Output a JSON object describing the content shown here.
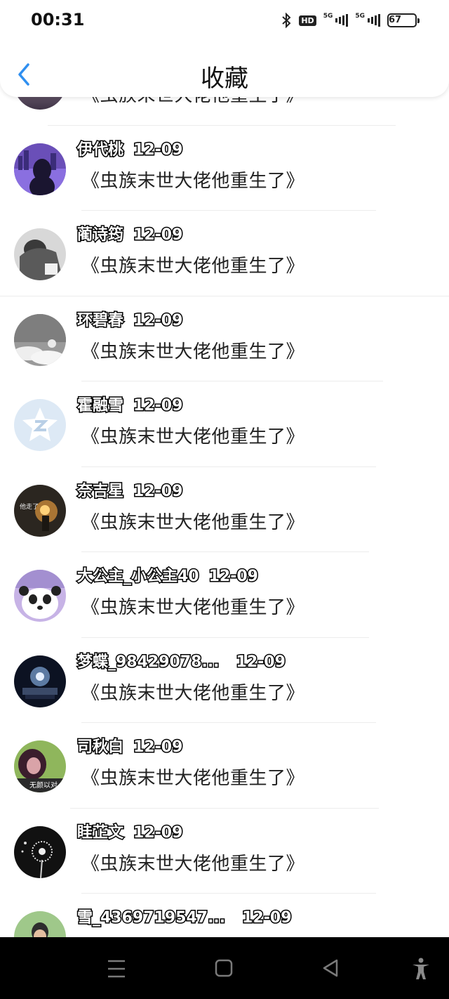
{
  "status_bar": {
    "time": "00:31",
    "hd_label": "HD",
    "signal_1_label": "5G",
    "signal_2_label": "5G",
    "battery": "67"
  },
  "header": {
    "title": "收藏",
    "back_icon": "chevron-left-icon"
  },
  "items": [
    {
      "name": "",
      "date": "",
      "title": "《虫族末世大佬他重生了》"
    },
    {
      "name": "伊代桃",
      "date": "12-09",
      "title": "《虫族末世大佬他重生了》"
    },
    {
      "name": "蔺诗筠",
      "date": "12-09",
      "title": "《虫族末世大佬他重生了》"
    },
    {
      "name": "环碧春",
      "date": "12-09",
      "title": "《虫族末世大佬他重生了》"
    },
    {
      "name": "霍融雪",
      "date": "12-09",
      "title": "《虫族末世大佬他重生了》"
    },
    {
      "name": "奈吉星",
      "date": "12-09",
      "title": "《虫族末世大佬他重生了》"
    },
    {
      "name": "大公主_小公主40",
      "date": "12-09",
      "title": "《虫族末世大佬他重生了》"
    },
    {
      "name": "梦蝶_98429078...",
      "date": "12-09",
      "title": "《虫族末世大佬他重生了》"
    },
    {
      "name": "司秋白",
      "date": "12-09",
      "title": "《虫族末世大佬他重生了》"
    },
    {
      "name": "眭芷文",
      "date": "12-09",
      "title": "《虫族末世大佬他重生了》"
    },
    {
      "name": "雪_4369719547...",
      "date": "12-09",
      "title": ""
    }
  ],
  "avatar_text": {
    "item5": "他走了",
    "item8": "无颜以对"
  },
  "colors": {
    "accent": "#2f8ff0",
    "nav_bg": "#000000",
    "separator": "#ececec"
  },
  "nav_icons": [
    "menu-icon",
    "home-square-icon",
    "back-triangle-icon",
    "accessibility-icon"
  ]
}
